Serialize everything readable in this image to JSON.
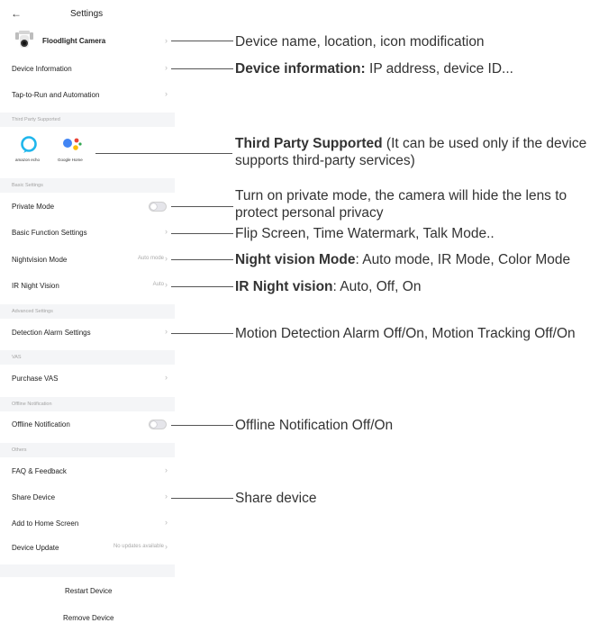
{
  "header": {
    "back_icon": "←",
    "title": "Settings"
  },
  "device": {
    "name": "Floodlight Camera"
  },
  "rows": {
    "device_information": "Device Information",
    "tap_to_run": "Tap-to-Run and Automation",
    "private_mode": "Private Mode",
    "basic_function": "Basic Function Settings",
    "nightvision_mode": "Nightvision Mode",
    "nightvision_mode_value": "Auto mode",
    "ir_night_vision": "IR Night Vision",
    "ir_night_vision_value": "Auto",
    "detection_alarm": "Detection Alarm Settings",
    "purchase_vas": "Purchase VAS",
    "offline_notification": "Offline Notification",
    "faq": "FAQ & Feedback",
    "share_device": "Share Device",
    "add_home": "Add to Home Screen",
    "device_update": "Device Update",
    "device_update_value": "No updates available"
  },
  "sections": {
    "third_party": "Third Party Supported",
    "basic_settings": "Basic Settings",
    "advanced_settings": "Advanced Settings",
    "vas": "VAS",
    "offline_notification": "Offline Notification",
    "others": "Others"
  },
  "third_party": {
    "alexa_label": "amazon echo",
    "google_label": "Google Home"
  },
  "buttons": {
    "restart": "Restart Device",
    "remove": "Remove Device"
  },
  "chevron": "›",
  "annotations": {
    "device_name": "Device name, location, icon modification",
    "device_info_bold": "Device information:",
    "device_info_rest": " IP address, device ID...",
    "third_party_bold": "Third Party Supported",
    "third_party_rest1": " (It can be used only if the device",
    "third_party_rest2": "supports third-party services)",
    "private_mode_1": "Turn on private mode, the camera will hide the lens to",
    "private_mode_2": "protect personal privacy",
    "basic_function": "Flip Screen, Time Watermark, Talk Mode..",
    "night_mode_bold": "Night vision Mode",
    "night_mode_rest": ": Auto mode, IR Mode, Color Mode",
    "ir_bold": "IR Night vision",
    "ir_rest": ": Auto, Off, On",
    "detection": "Motion Detection Alarm Off/On, Motion Tracking Off/On",
    "offline": "Offline Notification Off/On",
    "share": "Share device"
  }
}
